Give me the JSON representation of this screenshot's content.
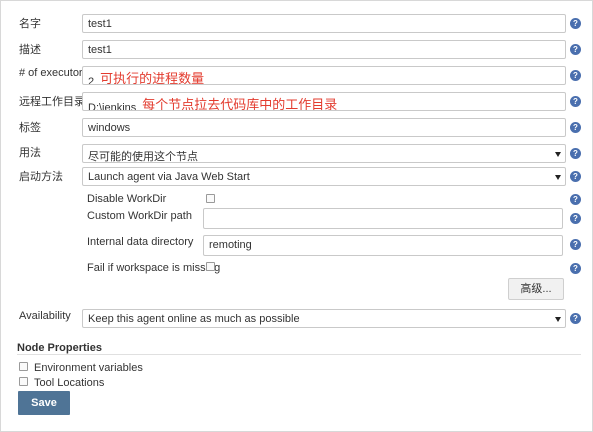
{
  "form": {
    "name_label": "名字",
    "name_value": "test1",
    "desc_label": "描述",
    "desc_value": "test1",
    "executors_label": "# of executors",
    "executors_value": "2",
    "executors_note": "可执行的进程数量",
    "remote_dir_label": "远程工作目录",
    "remote_dir_value": "D:\\jenkins",
    "remote_dir_note": "每个节点拉去代码库中的工作目录",
    "labels_label": "标签",
    "labels_value": "windows",
    "usage_label": "用法",
    "usage_value": "尽可能的使用这个节点",
    "launch_label": "启动方法",
    "launch_value": "Launch agent via Java Web Start",
    "disable_workdir_label": "Disable WorkDir",
    "custom_workdir_label": "Custom WorkDir path",
    "custom_workdir_value": "",
    "internal_dir_label": "Internal data directory",
    "internal_dir_value": "remoting",
    "fail_missing_label": "Fail if workspace is missing",
    "advanced_button": "高级...",
    "availability_label": "Availability",
    "availability_value": "Keep this agent online as much as possible"
  },
  "node_properties": {
    "title": "Node Properties",
    "env_vars_label": "Environment variables",
    "tool_locations_label": "Tool Locations"
  },
  "actions": {
    "save_label": "Save"
  },
  "icons": {
    "help_glyph": "?"
  },
  "colors": {
    "help_icon": "#4a6fae",
    "save_button": "#4f7496",
    "annotation_text": "#e33b2e"
  }
}
